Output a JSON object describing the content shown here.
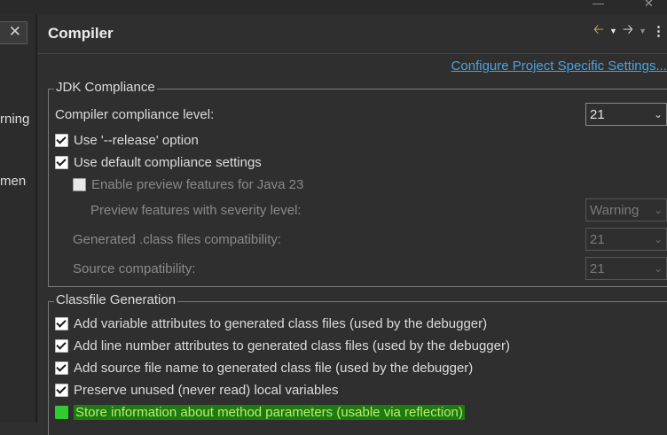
{
  "window": {
    "minimize_glyph": "—",
    "close_glyph": "✕"
  },
  "left_pane": {
    "search_clear_glyph": "✕",
    "items": [
      "rning",
      "men"
    ]
  },
  "header": {
    "title": "Compiler",
    "icons": [
      "back-arrow-icon",
      "forward-arrow-icon",
      "view-menu-icon"
    ]
  },
  "configure_link": "Configure Project Specific Settings...",
  "jdk": {
    "legend": "JDK Compliance",
    "compliance_label": "Compiler compliance level:",
    "compliance_value": "21",
    "release_option": {
      "label": "Use '--release' option",
      "checked": true
    },
    "default_settings": {
      "label": "Use default compliance settings",
      "checked": true
    },
    "preview_features": {
      "label": "Enable preview features for Java 23",
      "checked": false
    },
    "preview_severity": {
      "label": "Preview features with severity level:",
      "value": "Warning"
    },
    "generated_compat": {
      "label": "Generated .class files compatibility:",
      "value": "21"
    },
    "source_compat": {
      "label": "Source compatibility:",
      "value": "21"
    }
  },
  "classfile": {
    "legend": "Classfile Generation",
    "options": [
      {
        "label": "Add variable attributes to generated class files (used by the debugger)",
        "checked": true
      },
      {
        "label": "Add line number attributes to generated class files (used by the debugger)",
        "checked": true
      },
      {
        "label": "Add source file name to generated class file (used by the debugger)",
        "checked": true
      },
      {
        "label": "Preserve unused (never read) local variables",
        "checked": true
      },
      {
        "label": "Store information about method parameters (usable via reflection)",
        "checked": false
      }
    ]
  },
  "colors": {
    "accent_link": "#4aa3df",
    "highlight_bg": "#1f7a12",
    "highlight_fg": "#b5f06a",
    "back_arrow": "#e2b44a"
  }
}
